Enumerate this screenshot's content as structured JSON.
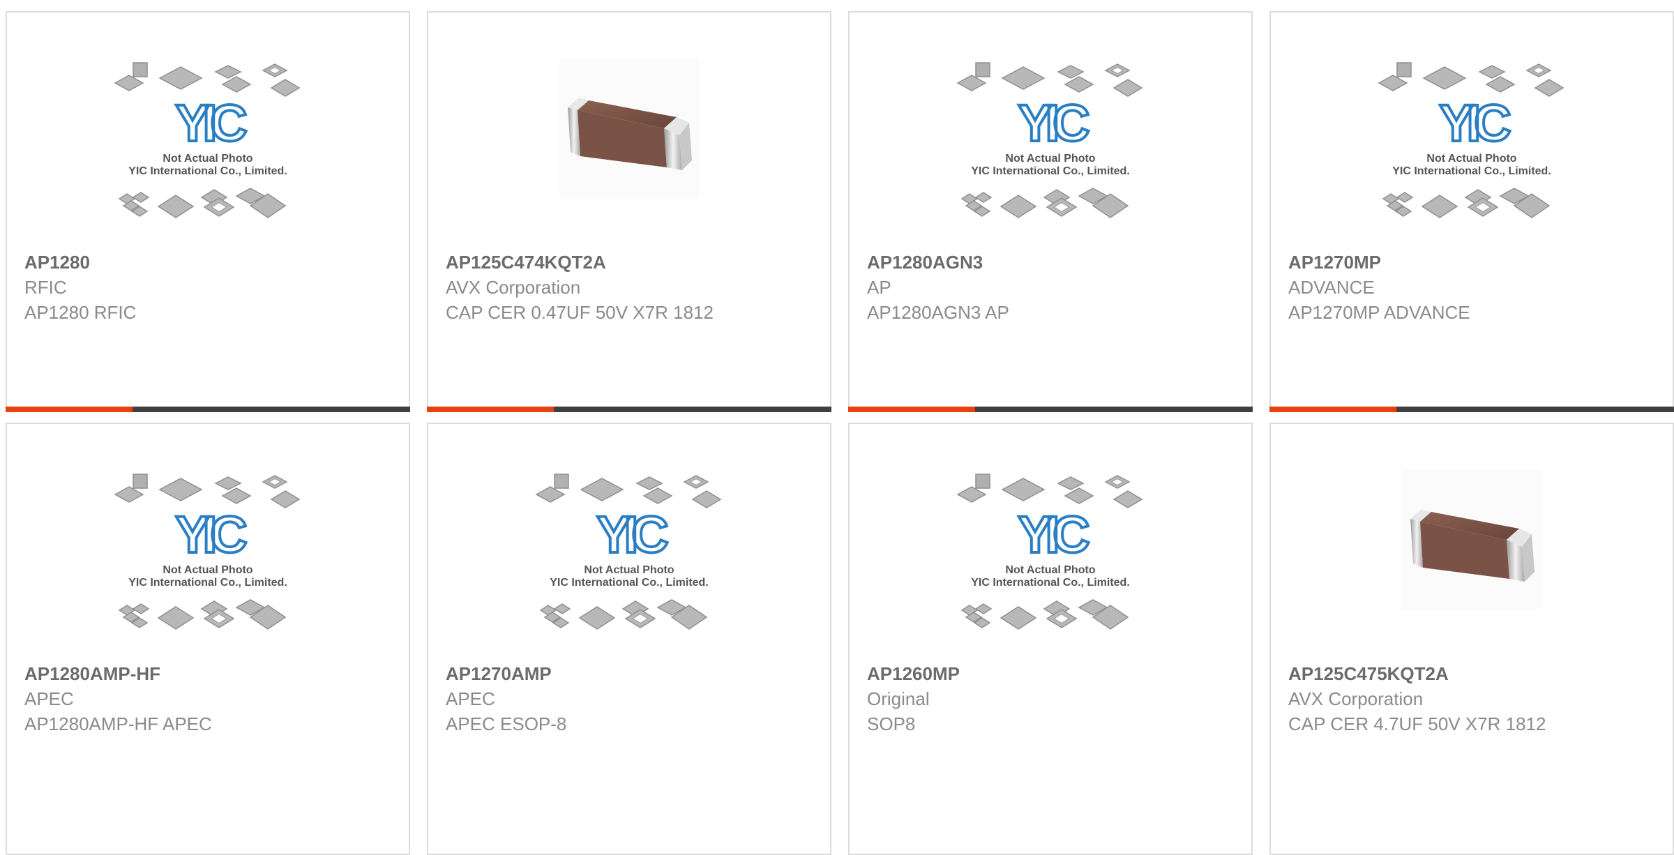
{
  "products": [
    {
      "part_number": "AP1280",
      "manufacturer": "RFIC",
      "description": "AP1280 RFIC",
      "image_type": "placeholder"
    },
    {
      "part_number": "AP125C474KQT2A",
      "manufacturer": "AVX Corporation",
      "description": "CAP CER 0.47UF 50V X7R 1812",
      "image_type": "capacitor"
    },
    {
      "part_number": "AP1280AGN3",
      "manufacturer": "AP",
      "description": "AP1280AGN3 AP",
      "image_type": "placeholder"
    },
    {
      "part_number": "AP1270MP",
      "manufacturer": "ADVANCE",
      "description": "AP1270MP ADVANCE",
      "image_type": "placeholder"
    },
    {
      "part_number": "AP1280AMP-HF",
      "manufacturer": "APEC",
      "description": "AP1280AMP-HF APEC",
      "image_type": "placeholder"
    },
    {
      "part_number": "AP1270AMP",
      "manufacturer": "APEC",
      "description": "APEC ESOP-8",
      "image_type": "placeholder"
    },
    {
      "part_number": "AP1260MP",
      "manufacturer": "Original",
      "description": "SOP8",
      "image_type": "placeholder"
    },
    {
      "part_number": "AP125C475KQT2A",
      "manufacturer": "AVX Corporation",
      "description": "CAP CER 4.7UF 50V X7R 1812",
      "image_type": "capacitor"
    }
  ],
  "placeholder_image": {
    "logo": "YIC",
    "line1": "Not Actual Photo",
    "line2": "YIC International Co., Limited."
  },
  "colors": {
    "accent": "#e8400f",
    "bar": "#3f3f3f",
    "logo_blue": "#2a7fc4",
    "border": "#dcdcdc",
    "capacitor_body": "#7a5346"
  }
}
